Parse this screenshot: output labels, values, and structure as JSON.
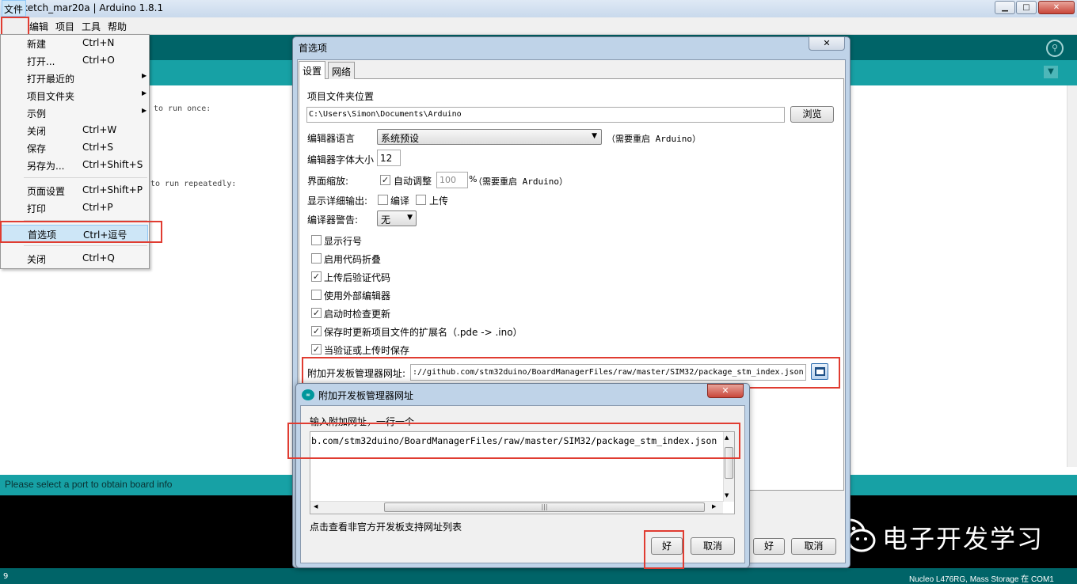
{
  "window": {
    "title": "sketch_mar20a | Arduino 1.8.1",
    "logo_text": "∞",
    "controls": {
      "minimize": "▁",
      "maximize": "□",
      "close": "✕"
    }
  },
  "menubar": {
    "file": "文件",
    "edit": "编辑",
    "sketch": "项目",
    "tools": "工具",
    "help": "帮助"
  },
  "file_menu": {
    "items": [
      {
        "label": "新建",
        "shortcut": "Ctrl+N"
      },
      {
        "label": "打开...",
        "shortcut": "Ctrl+O"
      },
      {
        "label": "打开最近的",
        "shortcut": "",
        "submenu": true
      },
      {
        "label": "项目文件夹",
        "shortcut": "",
        "submenu": true
      },
      {
        "label": "示例",
        "shortcut": "",
        "submenu": true
      },
      {
        "label": "关闭",
        "shortcut": "Ctrl+W"
      },
      {
        "label": "保存",
        "shortcut": "Ctrl+S"
      },
      {
        "label": "另存为...",
        "shortcut": "Ctrl+Shift+S"
      },
      {
        "label": "页面设置",
        "shortcut": "Ctrl+Shift+P"
      },
      {
        "label": "打印",
        "shortcut": "Ctrl+P"
      },
      {
        "label": "首选项",
        "shortcut": "Ctrl+逗号"
      },
      {
        "label": "关闭",
        "shortcut": "Ctrl+Q"
      }
    ],
    "submenu_arrow": "▶"
  },
  "editor": {
    "line1": "to run once:",
    "line2": "to run repeatedly:"
  },
  "status": {
    "message": "Please select a port to obtain board info",
    "line_number": "9",
    "board": "Nucleo L476RG, Mass Storage 在 COM1"
  },
  "toolbar": {
    "serial_monitor_icon": "⚲",
    "tab_menu_icon": "▼"
  },
  "preferences": {
    "title": "首选项",
    "close": "✕",
    "tabs": {
      "settings": "设置",
      "network": "网络"
    },
    "sketchbook_label": "项目文件夹位置",
    "sketchbook_path": "C:\\Users\\Simon\\Documents\\Arduino",
    "browse": "浏览",
    "language_label": "编辑器语言",
    "language_value": "系统预设",
    "restart_note": "（需要重启 Arduino）",
    "font_size_label": "编辑器字体大小",
    "font_size_value": "12",
    "scale_label": "界面缩放:",
    "auto_scale": "自动调整",
    "scale_value": "100",
    "scale_unit": "%",
    "scale_note": "（需要重启 Arduino）",
    "verbose_label": "显示详细输出:",
    "verbose_compile": "编译",
    "verbose_upload": "上传",
    "warnings_label": "编译器警告:",
    "warnings_value": "无",
    "checkboxes": [
      {
        "label": "显示行号",
        "checked": false
      },
      {
        "label": "启用代码折叠",
        "checked": false
      },
      {
        "label": "上传后验证代码",
        "checked": true
      },
      {
        "label": "使用外部编辑器",
        "checked": false
      },
      {
        "label": "启动时检查更新",
        "checked": true
      },
      {
        "label": "保存时更新项目文件的扩展名（.pde -> .ino）",
        "checked": true
      },
      {
        "label": "当验证或上传时保存",
        "checked": true
      }
    ],
    "boards_url_label": "附加开发板管理器网址:",
    "boards_url_value": "://github.com/stm32duino/BoardManagerFiles/raw/master/SIM32/package_stm_index.json",
    "ok": "好",
    "cancel": "取消"
  },
  "url_dialog": {
    "title": "附加开发板管理器网址",
    "close": "✕",
    "instruction": "输入附加网址，一行一个",
    "url_text": "b.com/stm32duino/BoardManagerFiles/raw/master/SIM32/package_stm_index.json",
    "link": "点击查看非官方开发板支持网址列表",
    "ok": "好",
    "cancel": "取消",
    "scroll_grip": "|||"
  },
  "watermark": {
    "text": "电子开发学习"
  }
}
